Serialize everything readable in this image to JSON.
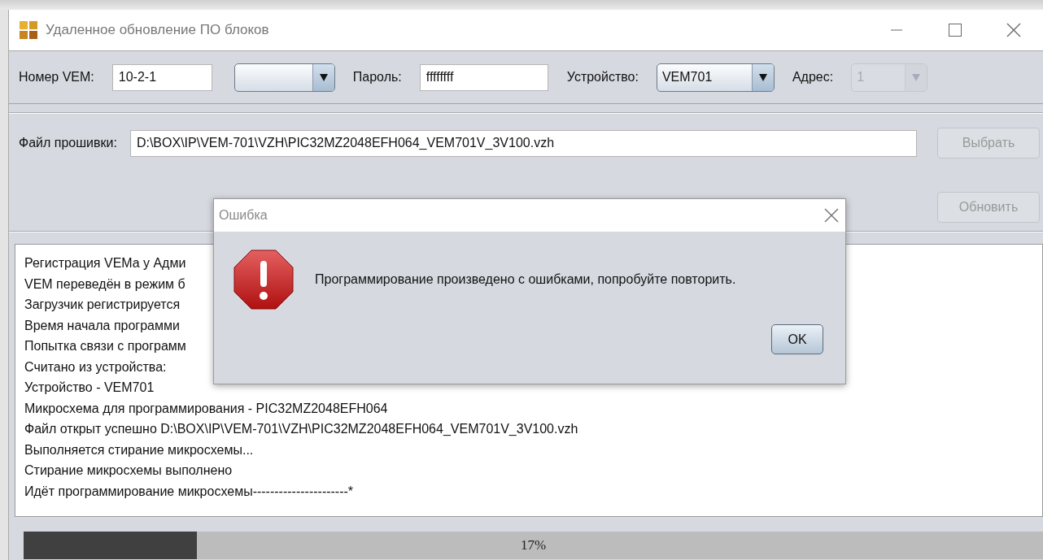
{
  "window": {
    "title": "Удаленное обновление ПО блоков"
  },
  "toolbar": [
    {
      "kind": "field",
      "label": "Номер VEM:",
      "value": "10-2-1"
    },
    {
      "kind": "combo",
      "disabled": false
    },
    {
      "kind": "field",
      "label": "Пароль:",
      "value": "ffffffff"
    },
    {
      "kind": "combo",
      "label": "Устройство:",
      "value": "VEM701",
      "disabled": false
    },
    {
      "kind": "combo",
      "label": "Адрес:",
      "value": "1",
      "disabled": true
    }
  ],
  "firmware": {
    "label": "Файл прошивки:",
    "value": "D:\\BOX\\IP\\VEM-701\\VZH\\PIC32MZ2048EFH064_VEM701V_3V100.vzh"
  },
  "buttons": [
    {
      "label": "Выбрать",
      "disabled": true
    },
    {
      "label": "Обновить",
      "disabled": true
    }
  ],
  "log": [
    "Регистрация VEMа у Адми",
    "VEM переведён в режим б",
    "Загрузчик регистрируется",
    "Время начала программи",
    "Попытка связи с программ",
    "Считано из устройства:",
    "Устройство - VEM701",
    "Микросхема для программирования - PIC32MZ2048EFH064",
    "Файл открыт успешно D:\\BOX\\IP\\VEM-701\\VZH\\PIC32MZ2048EFH064_VEM701V_3V100.vzh",
    "Выполняется стирание микросхемы...",
    "Стирание микросхемы выполнено",
    "Идёт программирование микросхемы----------------------*"
  ],
  "progress": {
    "level": 0.17,
    "label": "17%"
  },
  "dialog": {
    "title": "Ошибка",
    "message": "Программирование произведено с ошибками, попробуйте повторить.",
    "buttons": [
      "OK"
    ]
  }
}
